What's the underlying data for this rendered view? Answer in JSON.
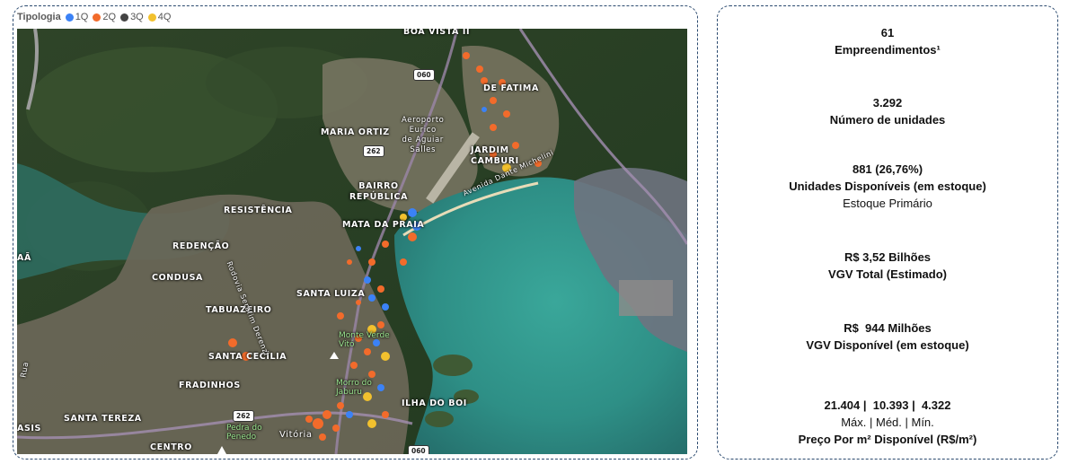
{
  "legend": {
    "title": "Tipologia",
    "items": [
      {
        "label": "1Q",
        "color": "#3b82f6"
      },
      {
        "label": "2Q",
        "color": "#f26b2b"
      },
      {
        "label": "3Q",
        "color": "#444444"
      },
      {
        "label": "4Q",
        "color": "#f2c12e"
      }
    ]
  },
  "map": {
    "places": {
      "boa_vista": "BOA VISTA II",
      "fatima": "DE FATIMA",
      "maria_ortiz": "MARIA ORTIZ",
      "aeroporto": "Aeroporto\nEurico\nde Aguiar\nSalles",
      "jardim_camburi": "JARDIM\nCAMBURI",
      "bairro_republica": "BAIRRO\nREPÚBLICA",
      "resistencia": "RESISTÊNCIA",
      "mata_da_praia": "MATA DA PRAIA",
      "redencao": "REDENÇÃO",
      "condusa": "CONDUSA",
      "santa_luiza": "SANTA LUIZA",
      "tabuazeiro": "TABUAZEIRO",
      "santa_cecilia": "SANTA CECÍLIA",
      "fradinhos": "FRADINHOS",
      "ilha_do_boi": "ILHA DO BOI",
      "santa_tereza": "SANTA TEREZA",
      "centro": "CENTRO",
      "vitoria": "Vitória",
      "aa": "AÃ",
      "asis": "ASIS",
      "monte_vito": "Monte Verde\nVitó",
      "morro_jaburu": "Morro do\nJaburu",
      "pedra_penedo": "Pedra do\nPenedo",
      "rodovia": "Rodovia Serafim Derenzi",
      "avenida": "Avenida Dante Michelini",
      "rua": "Rua"
    },
    "signs": {
      "s060a": "060",
      "s262a": "262",
      "s262b": "262",
      "s060b": "060"
    }
  },
  "stats": {
    "empreendimentos": {
      "value": "61",
      "label": "Empreendimentos¹"
    },
    "unidades": {
      "value": "3.292",
      "label": "Número de unidades"
    },
    "disponiveis": {
      "value": "881 (26,76%)",
      "label": "Unidades Disponíveis (em estoque)",
      "sub": "Estoque Primário"
    },
    "vgv_total": {
      "value": "R$ 3,52 Bilhões",
      "label": "VGV Total (Estimado)"
    },
    "vgv_disponivel": {
      "value": "R$  944 Milhões",
      "label": "VGV Disponível (em estoque)"
    },
    "preco": {
      "value": "21.404 |  10.393 |  4.322",
      "sub": "Máx. | Méd. | Mín.",
      "label": "Preço Por m² Disponível (R$/m²)"
    }
  }
}
